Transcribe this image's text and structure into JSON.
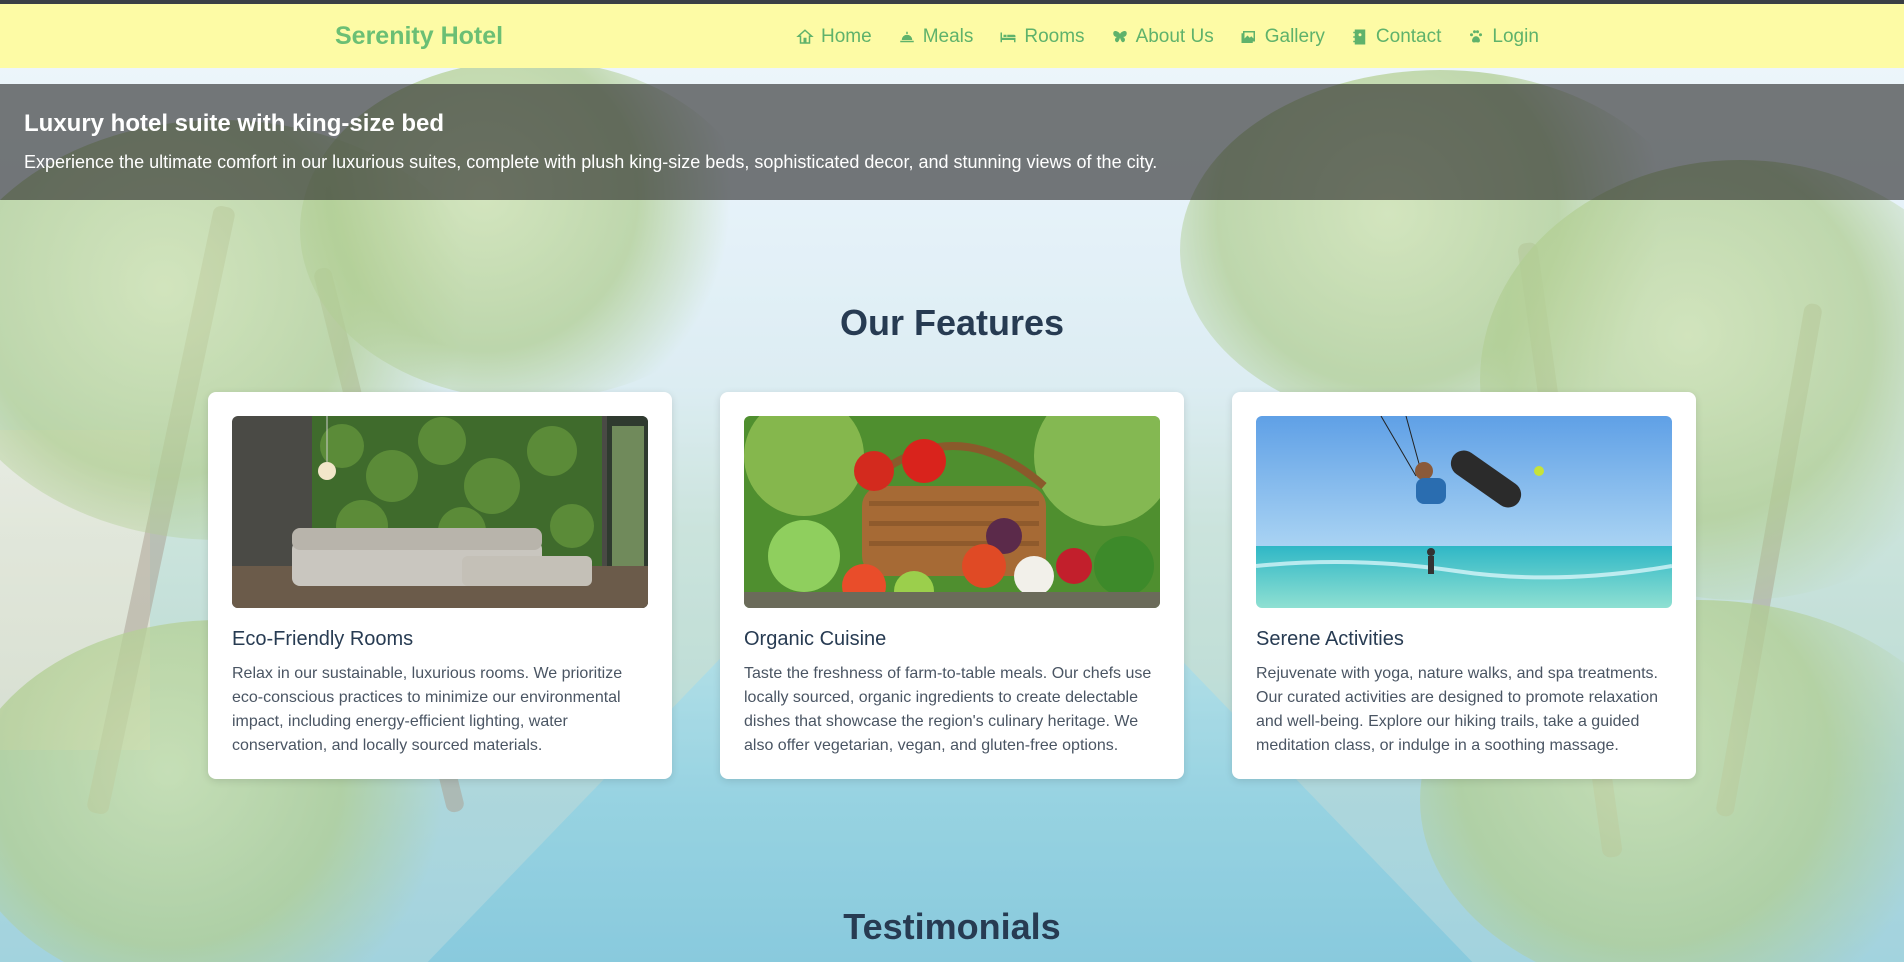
{
  "brand": {
    "name": "Serenity Hotel",
    "color": "#6bbf74"
  },
  "nav": {
    "background": "#fdfba5",
    "items": [
      {
        "label": "Home",
        "icon": "home-icon"
      },
      {
        "label": "Meals",
        "icon": "meals-icon"
      },
      {
        "label": "Rooms",
        "icon": "bed-icon"
      },
      {
        "label": "About Us",
        "icon": "butterfly-icon"
      },
      {
        "label": "Gallery",
        "icon": "gallery-icon"
      },
      {
        "label": "Contact",
        "icon": "contact-book-icon"
      },
      {
        "label": "Login",
        "icon": "paw-icon"
      }
    ]
  },
  "hero": {
    "caption_title": "Luxury hotel suite with king-size bed",
    "caption_text": "Experience the ultimate comfort in our luxurious suites, complete with plush king-size beds, sophisticated decor, and stunning views of the city."
  },
  "features": {
    "title": "Our Features",
    "cards": [
      {
        "title": "Eco-Friendly Rooms",
        "text": "Relax in our sustainable, luxurious rooms. We prioritize eco-conscious practices to minimize our environmental impact, including energy-efficient lighting, water conservation, and locally sourced materials.",
        "image": "living-room-green-wall"
      },
      {
        "title": "Organic Cuisine",
        "text": "Taste the freshness of farm-to-table meals. Our chefs use locally sourced, organic ingredients to create delectable dishes that showcase the region's culinary heritage. We also offer vegetarian, vegan, and gluten-free options.",
        "image": "vegetable-basket"
      },
      {
        "title": "Serene Activities",
        "text": "Rejuvenate with yoga, nature walks, and spa treatments. Our curated activities are designed to promote relaxation and well-being. Explore our hiking trails, take a guided meditation class, or indulge in a soothing massage.",
        "image": "kitesurfing"
      }
    ]
  },
  "testimonials": {
    "title": "Testimonials"
  },
  "colors": {
    "heading": "#273b52",
    "accent": "#5fb26b"
  }
}
